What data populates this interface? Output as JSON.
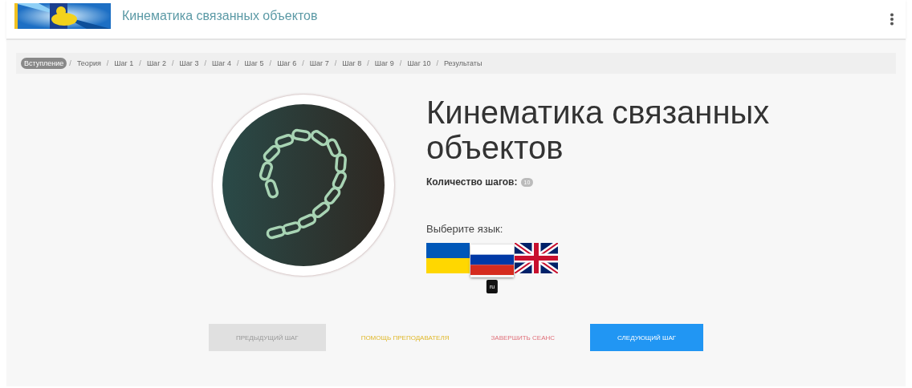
{
  "header": {
    "title": "Кинематика связанных объектов"
  },
  "breadcrumbs": [
    {
      "label": "Вступление",
      "selected": true
    },
    {
      "separator": "/",
      "label": "Теория",
      "selected": false
    },
    {
      "separator": "/",
      "label": "Шаг 1",
      "selected": false
    },
    {
      "separator": "/",
      "label": "Шаг 2",
      "selected": false
    },
    {
      "separator": "/",
      "label": "Шаг 3",
      "selected": false
    },
    {
      "separator": "/",
      "label": "Шаг 4",
      "selected": false
    },
    {
      "separator": "/",
      "label": "Шаг 5",
      "selected": false
    },
    {
      "separator": "/",
      "label": "Шаг 6",
      "selected": false
    },
    {
      "separator": "/",
      "label": "Шаг 7",
      "selected": false
    },
    {
      "separator": "/",
      "label": "Шаг 8",
      "selected": false
    },
    {
      "separator": "/",
      "label": "Шаг 9",
      "selected": false
    },
    {
      "separator": "/",
      "label": "Шаг 10",
      "selected": false
    },
    {
      "separator": "/",
      "label": "Результаты",
      "selected": false
    }
  ],
  "intro": {
    "title": "Кинематика связанных объектов",
    "steps_label": "Количество шагов:",
    "steps_count": "10",
    "language_label": "Выберите язык:",
    "languages": [
      {
        "kind": "ua",
        "selected": false
      },
      {
        "kind": "ru",
        "selected": true,
        "tooltip": "ru"
      },
      {
        "kind": "gb",
        "selected": false
      }
    ]
  },
  "buttons": [
    {
      "label": "ПРЕДЫДУЩИЙ ШАГ",
      "kind": "secondary",
      "disabled": true
    },
    {
      "label": "ПОМОЩЬ ПРЕПОДАВАТЕЛЯ",
      "kind": "warning",
      "disabled": false
    },
    {
      "label": "ЗАВЕРШИТЬ СЕАНС",
      "kind": "danger",
      "disabled": false
    },
    {
      "label": "СЛЕДУЮЩИЙ ШАГ",
      "kind": "primary",
      "disabled": false
    }
  ]
}
